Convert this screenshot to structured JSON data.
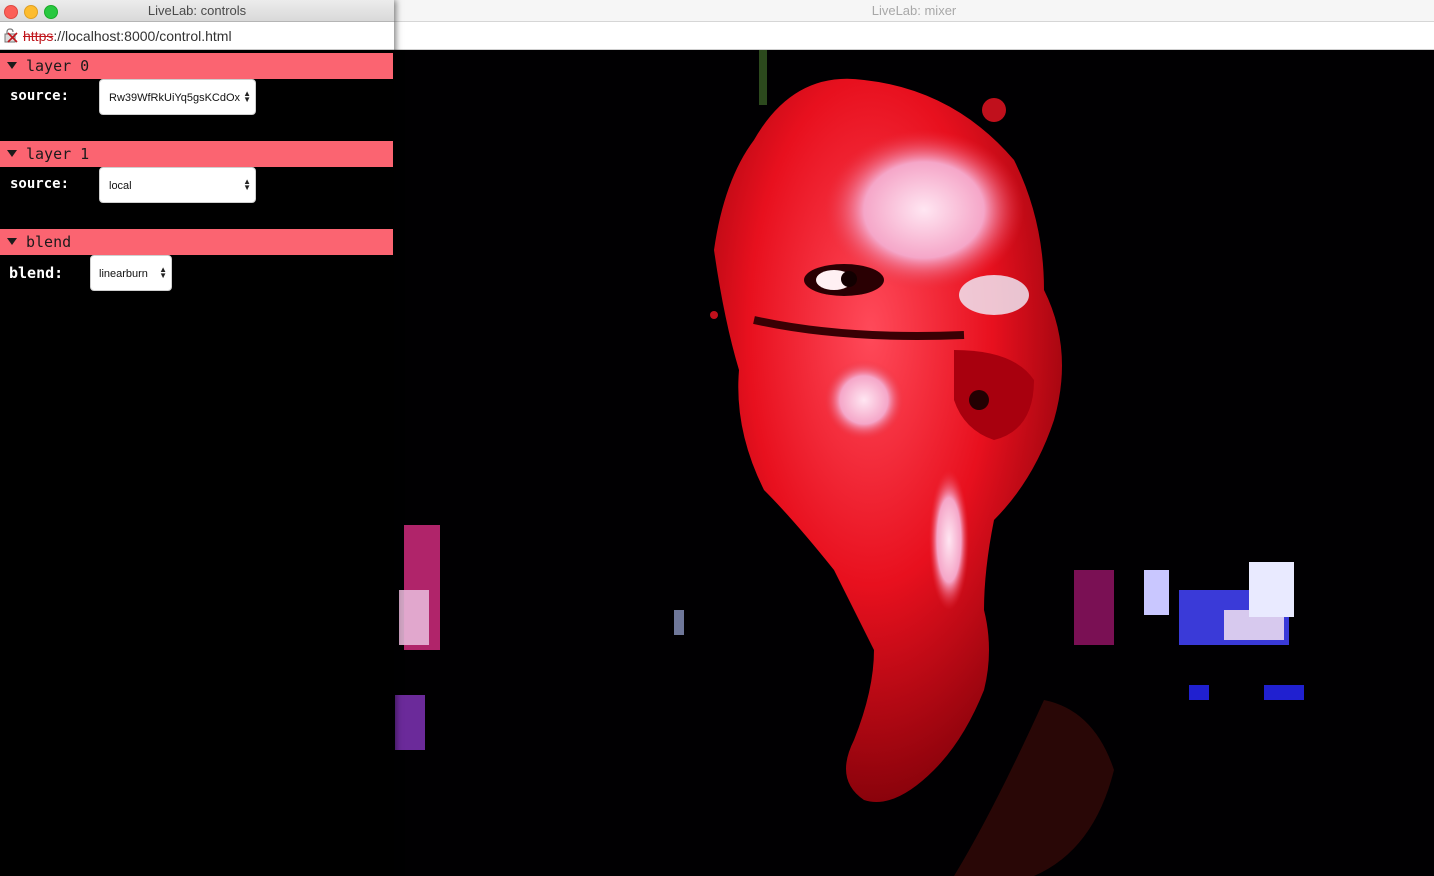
{
  "mixer_window": {
    "title": "LiveLab: mixer"
  },
  "controls_window": {
    "title": "LiveLab: controls",
    "address": {
      "scheme": "https",
      "rest": "://localhost:8000/control.html"
    }
  },
  "sections": [
    {
      "header": "layer 0",
      "label": "source:",
      "value": "Rw39WfRkUiYq5gsKCdOx"
    },
    {
      "header": "layer 1",
      "label": "source:",
      "value": "local"
    },
    {
      "header": "blend",
      "label": "blend:",
      "value": "linearburn"
    }
  ],
  "colors": {
    "section_header": "#fb6471",
    "background": "#000000"
  },
  "icons": {
    "insecure": "broken-lock-icon",
    "toggle": "triangle-down-icon",
    "select": "up-down-arrows-icon"
  }
}
